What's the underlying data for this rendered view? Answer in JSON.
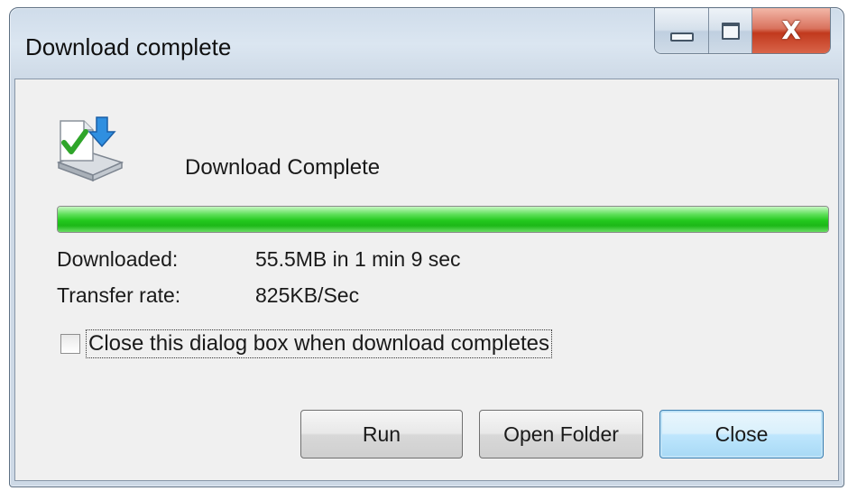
{
  "window": {
    "title": "Download complete"
  },
  "caption": {
    "minimize_icon": "minimize-icon",
    "maximize_icon": "maximize-icon",
    "close_glyph": "X"
  },
  "content": {
    "icon": "file-download-complete-icon",
    "heading": "Download Complete",
    "progress_fraction": 1.0,
    "downloaded_label": "Downloaded:",
    "downloaded_value": "55.5MB in 1 min 9 sec",
    "rate_label": "Transfer rate:",
    "rate_value": "825KB/Sec",
    "checkbox_label": "Close this dialog box when download completes",
    "checkbox_checked": false
  },
  "buttons": {
    "run": "Run",
    "open_folder": "Open Folder",
    "close": "Close"
  },
  "colors": {
    "progress_green": "#23c81d",
    "close_button_red": "#c1391d",
    "default_button_blue": "#bee6fd"
  }
}
